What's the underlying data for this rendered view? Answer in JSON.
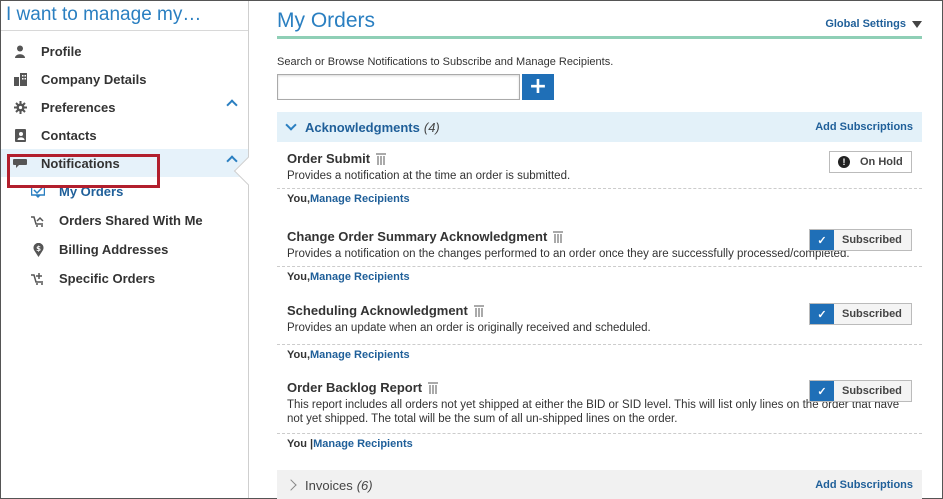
{
  "sidebar": {
    "title": "I want to manage my…",
    "items": [
      {
        "label": "Profile",
        "icon": "person-icon"
      },
      {
        "label": "Company Details",
        "icon": "building-icon"
      },
      {
        "label": "Preferences",
        "icon": "gear-icon"
      },
      {
        "label": "Contacts",
        "icon": "address-book-icon"
      },
      {
        "label": "Notifications",
        "icon": "chat-bubble-icon"
      }
    ],
    "subitems": [
      {
        "label": "My Orders",
        "icon": "inbox-icon"
      },
      {
        "label": "Orders Shared With Me",
        "icon": "shared-cart-icon"
      },
      {
        "label": "Billing Addresses",
        "icon": "location-pin-icon"
      },
      {
        "label": "Specific Orders",
        "icon": "cart-icon"
      }
    ]
  },
  "main": {
    "title": "My Orders",
    "global_settings": "Global Settings",
    "search_hint": "Search or Browse Notifications to Subscribe and Manage Recipients.",
    "search_value": "",
    "add_button": "+",
    "sections": [
      {
        "title": "Acknowledgments",
        "count": "(4)",
        "add_label": "Add Subscriptions",
        "rows": [
          {
            "title": "Order Submit",
            "desc": "Provides a notification at the time an order is submitted.",
            "status": "On Hold",
            "status_icon": "!",
            "foot_prefix": "You, ",
            "foot_link": "Manage Recipients"
          },
          {
            "title": "Change Order Summary Acknowledgment",
            "desc": "Provides a notification on the changes performed to an order once they are successfully processed/completed.",
            "status": "Subscribed",
            "status_icon": "✓",
            "foot_prefix": "You, ",
            "foot_link": "Manage Recipients"
          },
          {
            "title": "Scheduling Acknowledgment",
            "desc": "Provides an update when an order is originally received and scheduled.",
            "status": "Subscribed",
            "status_icon": "✓",
            "foot_prefix": "You, ",
            "foot_link": "Manage Recipients"
          },
          {
            "title": "Order Backlog Report",
            "desc": "This report includes all orders not yet shipped at either the BID or SID level. This will list only lines on the order that have not yet shipped. The total will be the sum of all un-shipped lines on the order.",
            "status": "Subscribed",
            "status_icon": "✓",
            "foot_prefix": "You | ",
            "foot_link": "Manage Recipients"
          }
        ]
      },
      {
        "title": "Invoices",
        "count": "(6)",
        "add_label": "Add Subscriptions"
      }
    ]
  },
  "colors": {
    "accent_blue": "#2a7fc1",
    "link_blue": "#1f5f99",
    "button_blue": "#1f6fb7",
    "highlight_red": "#b21f2d",
    "header_underline": "#8fcfb6"
  }
}
